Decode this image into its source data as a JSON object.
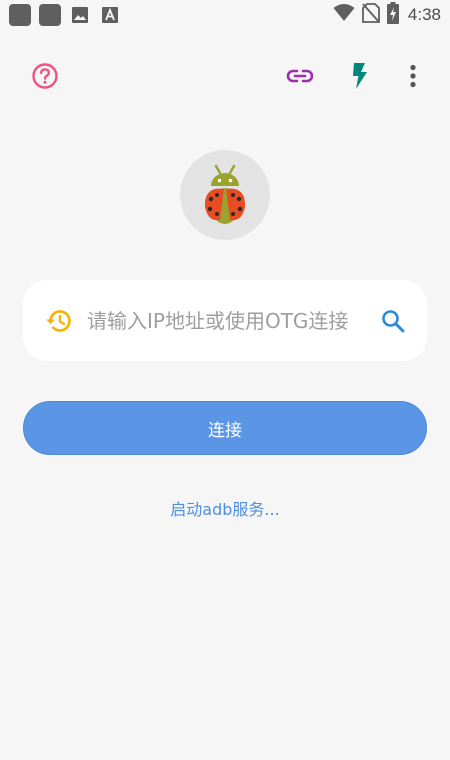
{
  "status_bar": {
    "time": "4:38",
    "notification_icons": [
      "app-icon",
      "app-icon",
      "image-icon",
      "text-a-icon"
    ],
    "system_icons": [
      "wifi-icon",
      "no-sim-icon",
      "battery-charging-icon"
    ]
  },
  "toolbar": {
    "icons": [
      "help-icon",
      "link-icon",
      "flash-icon",
      "more-vert-icon"
    ]
  },
  "colors": {
    "help": "#ef5383",
    "link": "#9b2fb0",
    "flash": "#00897b",
    "menu": "#555555",
    "history": "#f4b400",
    "search": "#2c8ad6",
    "button": "#5b96e6",
    "link_text": "#4e8fe0"
  },
  "input": {
    "placeholder": "请输入IP地址或使用OTG连接"
  },
  "connect_button": {
    "label": "连接"
  },
  "adb_link": {
    "label": "启动adb服务..."
  }
}
